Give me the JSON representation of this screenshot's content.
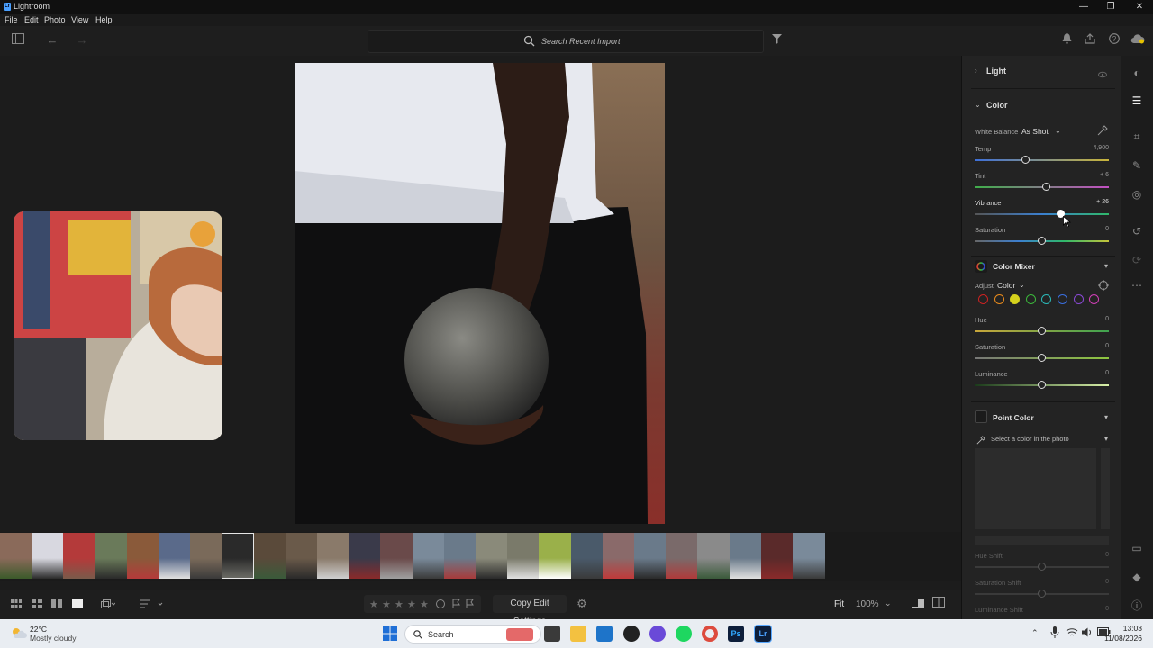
{
  "window": {
    "title": "Lightroom",
    "controls": [
      "—",
      "❐",
      "✕"
    ]
  },
  "menu": [
    "File",
    "Edit",
    "Photo",
    "View",
    "Help"
  ],
  "toolbar": {
    "search_placeholder": "Search Recent Import"
  },
  "bottom": {
    "copy_edit_settings": "Copy Edit Settings",
    "fit": "Fit",
    "zoom": "100%"
  },
  "panel": {
    "light": {
      "label": "Light"
    },
    "color": {
      "label": "Color",
      "white_balance_label": "White Balance",
      "white_balance_value": "As Shot",
      "sliders": [
        {
          "name": "Temp",
          "value": "4,900",
          "pos": 0.38
        },
        {
          "name": "Tint",
          "value": "+ 6",
          "pos": 0.53
        },
        {
          "name": "Vibrance",
          "value": "+ 26",
          "pos": 0.64
        },
        {
          "name": "Saturation",
          "value": "0",
          "pos": 0.5
        }
      ]
    },
    "color_mixer": {
      "label": "Color Mixer",
      "adjust_label": "Adjust",
      "adjust_value": "Color",
      "swatches": [
        "#c22",
        "#e88a1c",
        "#d6d21d",
        "#3bb83b",
        "#2bb9b9",
        "#3a6fe0",
        "#8a4ad6",
        "#d23fb8"
      ],
      "sliders": [
        {
          "name": "Hue",
          "value": "0",
          "pos": 0.5
        },
        {
          "name": "Saturation",
          "value": "0",
          "pos": 0.5
        },
        {
          "name": "Luminance",
          "value": "0",
          "pos": 0.5
        }
      ]
    },
    "point_color": {
      "label": "Point Color",
      "select_text": "Select a color in the photo",
      "sliders": [
        {
          "name": "Hue Shift",
          "value": "0"
        },
        {
          "name": "Saturation Shift",
          "value": "0"
        },
        {
          "name": "Luminance Shift",
          "value": "0"
        }
      ]
    }
  },
  "taskbar": {
    "weather_temp": "22°C",
    "weather_desc": "Mostly cloudy",
    "search": "Search",
    "time": "13:03",
    "date": "11/08/2026"
  }
}
